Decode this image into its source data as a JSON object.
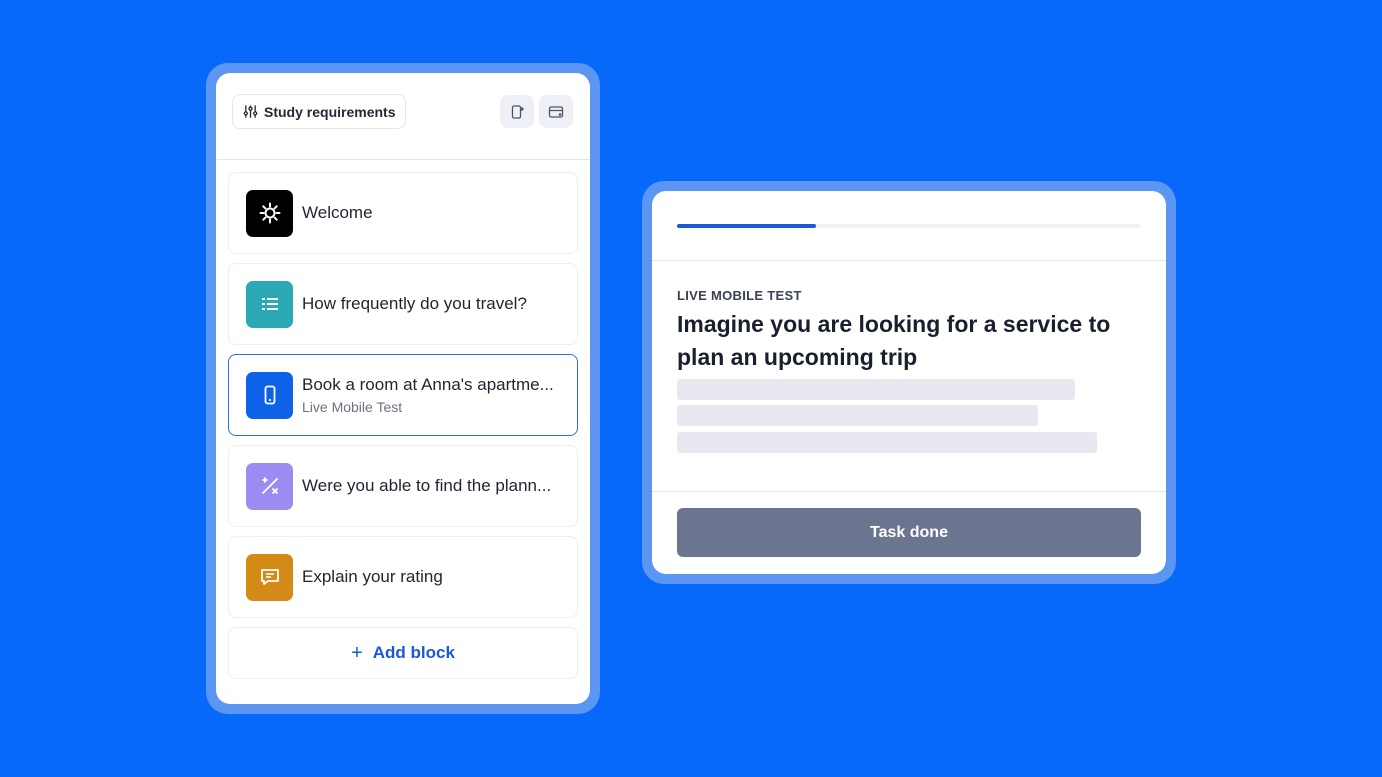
{
  "builder": {
    "requirements_label": "Study requirements",
    "blocks": [
      {
        "title": "Welcome",
        "subtitle": "",
        "icon": "gear-icon",
        "color": "#000000"
      },
      {
        "title": "How frequently do you travel?",
        "subtitle": "",
        "icon": "list-icon",
        "color": "#2aa8b4"
      },
      {
        "title": "Book a room at Anna's apartme...",
        "subtitle": "Live Mobile Test",
        "icon": "mobile-phone-icon",
        "color": "#0d62e8"
      },
      {
        "title": "Were you able to find the plann...",
        "subtitle": "",
        "icon": "percent-icon",
        "color": "#9b8cf4"
      },
      {
        "title": "Explain your rating",
        "subtitle": "",
        "icon": "message-icon",
        "color": "#d48a17"
      }
    ],
    "add_block_label": "Add block"
  },
  "preview": {
    "progress_percent": 30,
    "eyebrow": "LIVE MOBILE TEST",
    "headline": "Imagine you are looking for a service to plan an upcoming trip",
    "task_button_label": "Task done"
  }
}
